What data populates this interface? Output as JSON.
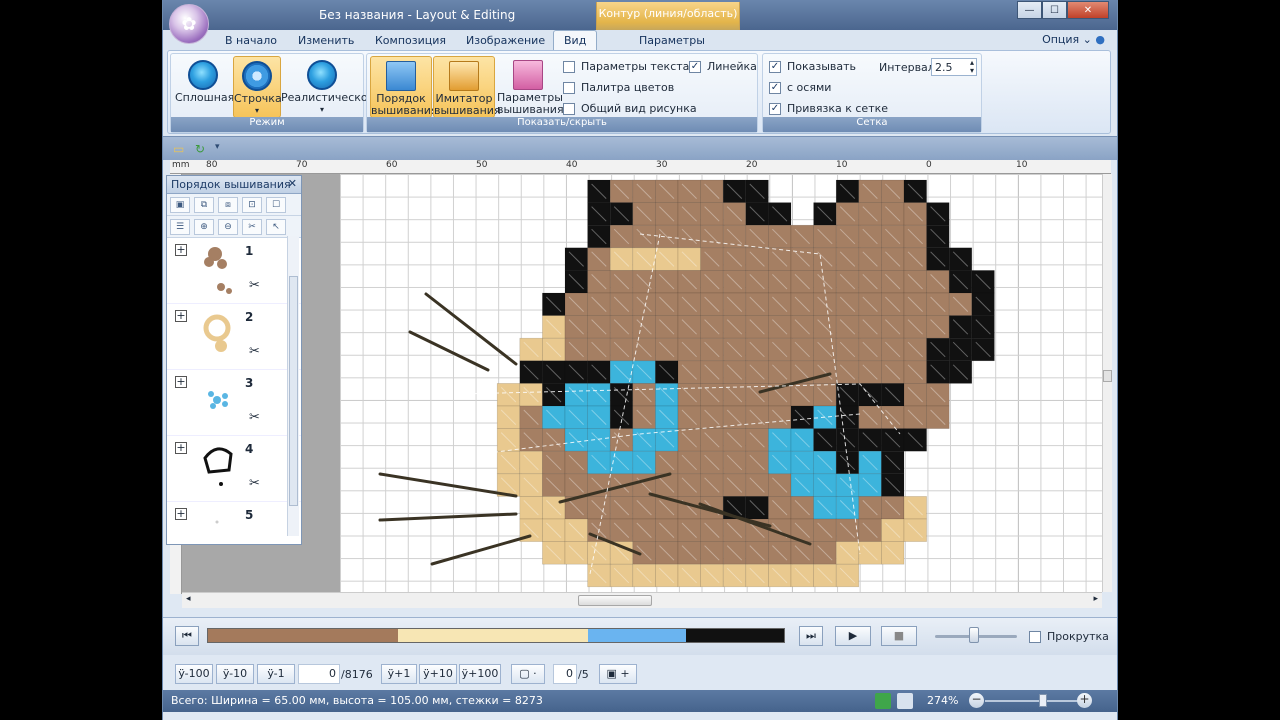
{
  "window": {
    "title": "Без названия - Layout & Editing",
    "context_tab_title": "Контур (линия/область)",
    "controls": {
      "minimize": "—",
      "maximize": "☐",
      "close": "✕"
    }
  },
  "menu_tabs": [
    {
      "label": "В начало"
    },
    {
      "label": "Изменить"
    },
    {
      "label": "Композиция"
    },
    {
      "label": "Изображение"
    },
    {
      "label": "Вид",
      "active": true
    },
    {
      "label": "Параметры"
    }
  ],
  "options_label": "Опция",
  "ribbon": {
    "mode_group": {
      "label": "Режим",
      "buttons": [
        {
          "label": "Сплошная"
        },
        {
          "label": "Строчка",
          "selected": true
        },
        {
          "label": "Реалистическое"
        }
      ]
    },
    "show_group": {
      "label": "Показать/скрыть",
      "buttons": [
        {
          "label_line1": "Порядок",
          "label_line2": "вышивания",
          "selected": true
        },
        {
          "label_line1": "Имитатор",
          "label_line2": "вышивания",
          "selected": true
        },
        {
          "label_line1": "Параметры",
          "label_line2": "вышивания"
        }
      ],
      "checkboxes": [
        {
          "label": "Параметры текста",
          "checked": false
        },
        {
          "label": "Палитра цветов",
          "checked": false
        },
        {
          "label": "Общий вид рисунка",
          "checked": false
        },
        {
          "label": "Линейка",
          "checked": true
        }
      ]
    },
    "grid_group": {
      "label": "Сетка",
      "checkboxes": [
        {
          "label": "Показывать",
          "checked": true
        },
        {
          "label": "с осями",
          "checked": true
        },
        {
          "label": "Привязка к сетке",
          "checked": true
        }
      ],
      "interval_label": "Интервал:",
      "interval_value": "2.5"
    }
  },
  "ruler_labels": [
    "80",
    "70",
    "60",
    "50",
    "40",
    "30",
    "20",
    "10",
    "0",
    "10"
  ],
  "side_panel": {
    "title": "Порядок вышивания",
    "items": [
      {
        "num": "1",
        "color": "#a57f63"
      },
      {
        "num": "2",
        "color": "#e9c98f"
      },
      {
        "num": "3",
        "color": "#5ab6e3"
      },
      {
        "num": "4",
        "color": "#111111"
      },
      {
        "num": "5",
        "color": "#cccccc"
      }
    ]
  },
  "player": {
    "segments": [
      {
        "color": "#a47a5c",
        "fraction": 0.33
      },
      {
        "color": "#f7e6b4",
        "fraction": 0.33
      },
      {
        "color": "#6ab4f0",
        "fraction": 0.17
      },
      {
        "color": "#111111",
        "fraction": 0.17
      }
    ],
    "scroll_label": "Прокрутка"
  },
  "nav": {
    "back100": "-100",
    "back10": "-10",
    "back1": "-1",
    "stitch_value": "0",
    "stitch_total": "/8176",
    "fwd1": "+1",
    "fwd10": "+10",
    "fwd100": "+100",
    "obj_value": "0",
    "obj_total": "/5"
  },
  "status": {
    "text": "Всего: Ширина = 65.00 мм, высота = 105.00 мм, стежки = 8273",
    "zoom": "274%"
  },
  "colors": {
    "fabric_brown": "#a57f63",
    "cream": "#e9c98f",
    "eye_blue": "#3cb4dc",
    "outline_black": "#111111"
  }
}
